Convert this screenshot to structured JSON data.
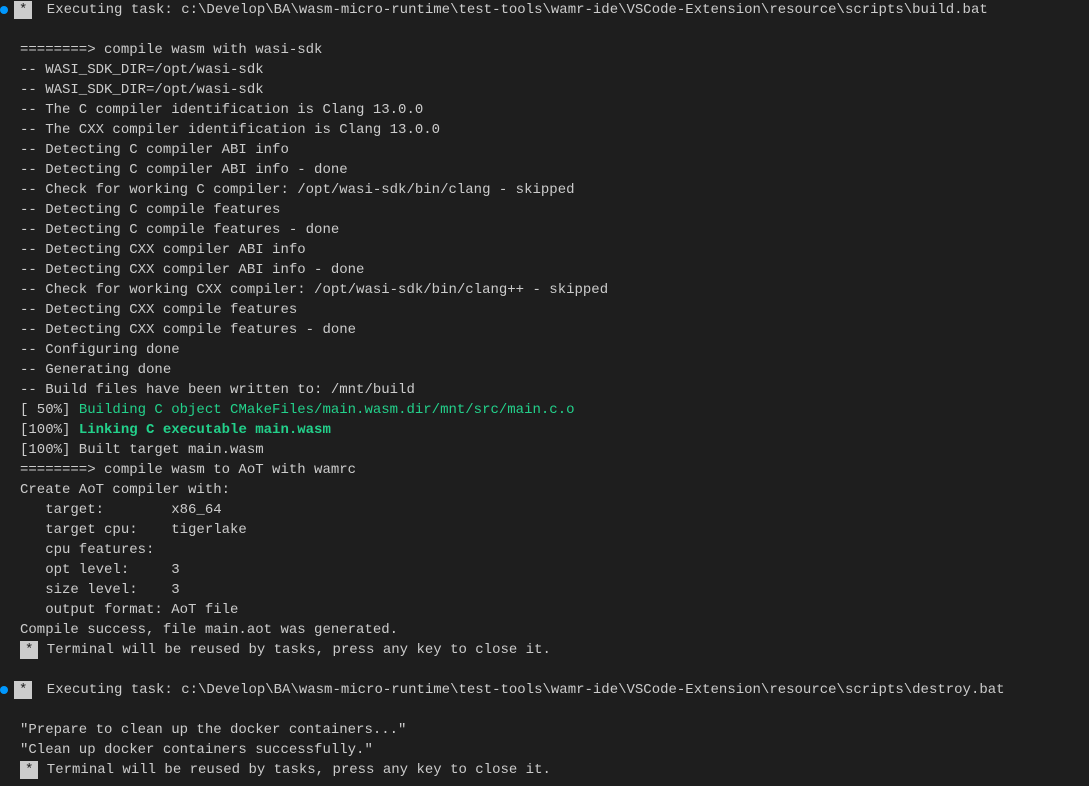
{
  "task1": {
    "asterisk": "*",
    "label": " Executing task: c:\\Develop\\BA\\wasm-micro-runtime\\test-tools\\wamr-ide\\VSCode-Extension\\resource\\scripts\\build.bat ",
    "lines": [
      "========> compile wasm with wasi-sdk",
      "-- WASI_SDK_DIR=/opt/wasi-sdk",
      "-- WASI_SDK_DIR=/opt/wasi-sdk",
      "-- The C compiler identification is Clang 13.0.0",
      "-- The CXX compiler identification is Clang 13.0.0",
      "-- Detecting C compiler ABI info",
      "-- Detecting C compiler ABI info - done",
      "-- Check for working C compiler: /opt/wasi-sdk/bin/clang - skipped",
      "-- Detecting C compile features",
      "-- Detecting C compile features - done",
      "-- Detecting CXX compiler ABI info",
      "-- Detecting CXX compiler ABI info - done",
      "-- Check for working CXX compiler: /opt/wasi-sdk/bin/clang++ - skipped",
      "-- Detecting CXX compile features",
      "-- Detecting CXX compile features - done",
      "-- Configuring done",
      "-- Generating done",
      "-- Build files have been written to: /mnt/build"
    ],
    "build50_pct": "[ 50%] ",
    "build50_msg": "Building C object CMakeFiles/main.wasm.dir/mnt/src/main.c.o",
    "build100_pct": "[100%] ",
    "build100_msg": "Linking C executable main.wasm",
    "built_target": "[100%] Built target main.wasm",
    "lines_after": [
      "========> compile wasm to AoT with wamrc",
      "Create AoT compiler with:",
      "   target:        x86_64",
      "   target cpu:    tigerlake",
      "   cpu features:  ",
      "   opt level:     3",
      "   size level:    3",
      "   output format: AoT file",
      "Compile success, file main.aot was generated."
    ],
    "close_asterisk": "*",
    "close_msg": " Terminal will be reused by tasks, press any key to close it."
  },
  "task2": {
    "asterisk": "*",
    "label": " Executing task: c:\\Develop\\BA\\wasm-micro-runtime\\test-tools\\wamr-ide\\VSCode-Extension\\resource\\scripts\\destroy.bat",
    "lines": [
      "\"Prepare to clean up the docker containers...\"",
      "\"Clean up docker containers successfully.\""
    ],
    "close_asterisk": "*",
    "close_msg": " Terminal will be reused by tasks, press any key to close it."
  }
}
